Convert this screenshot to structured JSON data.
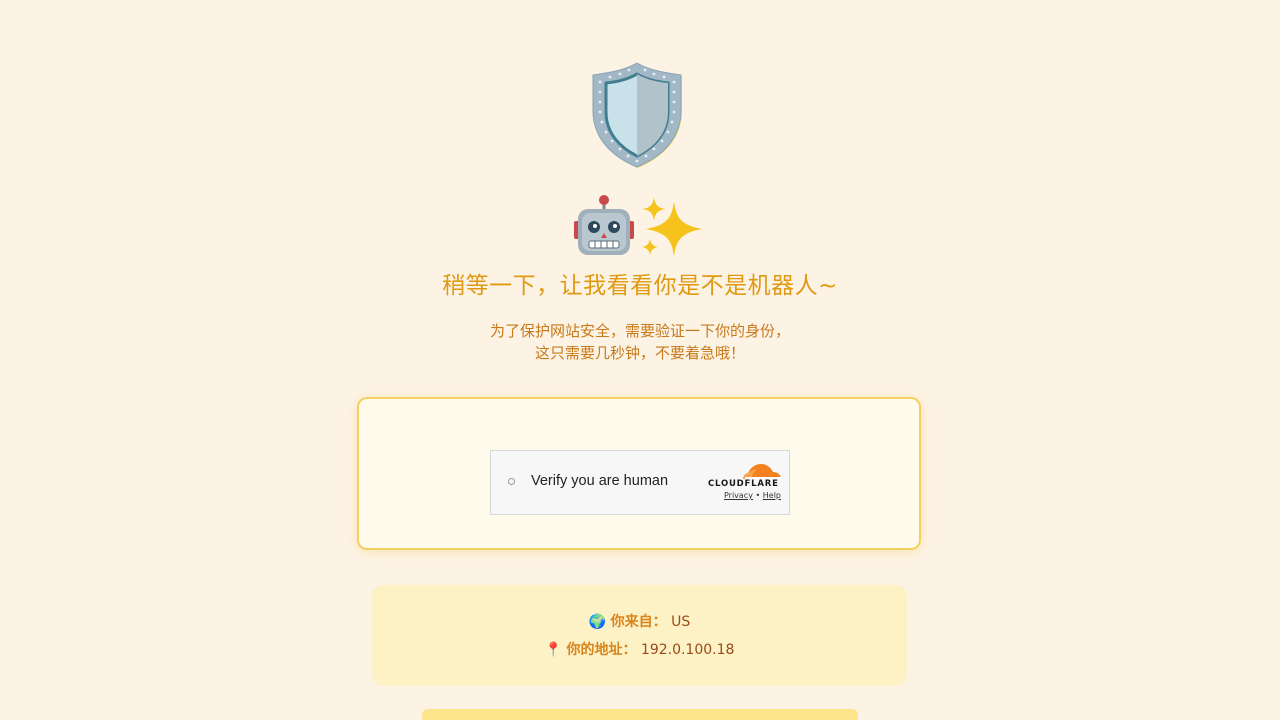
{
  "header": {
    "title": "稍等一下，让我看看你是不是机器人~",
    "subtitle_line1": "为了保护网站安全，需要验证一下你的身份，",
    "subtitle_line2": "这只需要几秒钟，不要着急哦！",
    "emoji": "🤖✨",
    "shield_icon": "shield-icon"
  },
  "captcha": {
    "label": "Verify you are human",
    "brand": "CLOUDFLARE",
    "privacy_link": "Privacy",
    "separator": "•",
    "help_link": "Help",
    "checked": false
  },
  "info": {
    "country_icon": "🌍",
    "country_label": "你来自：",
    "country_value": "US",
    "address_icon": "📍",
    "address_label": "你的地址：",
    "address_value": "192.0.100.18"
  },
  "colors": {
    "background": "#fdf3e4",
    "accent": "#e09a12",
    "cloudflare_orange": "#f48120"
  }
}
